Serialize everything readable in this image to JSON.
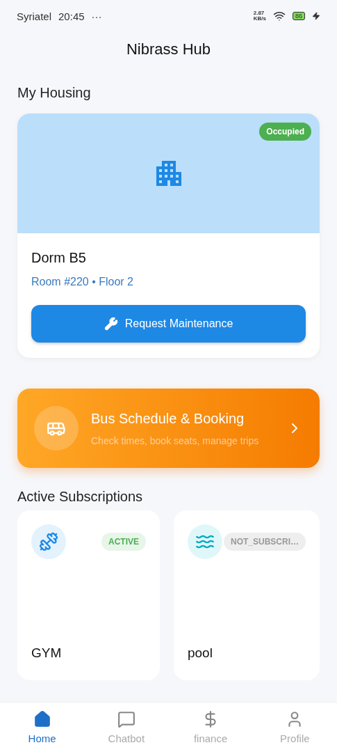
{
  "status_bar": {
    "carrier": "Syriatel",
    "time": "20:45",
    "dots": "···",
    "speed": "2.87",
    "speed_unit": "KB/s",
    "battery": "86",
    "charging": true
  },
  "header": {
    "title": "Nibrass Hub"
  },
  "housing": {
    "heading": "My Housing",
    "badge": "Occupied",
    "name": "Dorm B5",
    "details": "Room #220 • Floor 2",
    "button": "Request Maintenance"
  },
  "bus": {
    "title": "Bus Schedule & Booking",
    "subtitle": "Check times, book seats, manage trips"
  },
  "subscriptions": {
    "heading": "Active Subscriptions",
    "items": [
      {
        "kind": "gym",
        "name": "GYM",
        "status": "ACTIVE",
        "active": true
      },
      {
        "kind": "pool",
        "name": "pool",
        "status": "NOT_SUBSCRI…",
        "active": false
      }
    ]
  },
  "nav": [
    {
      "kind": "home",
      "label": "Home",
      "selected": true
    },
    {
      "kind": "chat",
      "label": "Chatbot",
      "selected": false
    },
    {
      "kind": "finance",
      "label": "finance",
      "selected": false
    },
    {
      "kind": "profile",
      "label": "Profile",
      "selected": false
    }
  ]
}
